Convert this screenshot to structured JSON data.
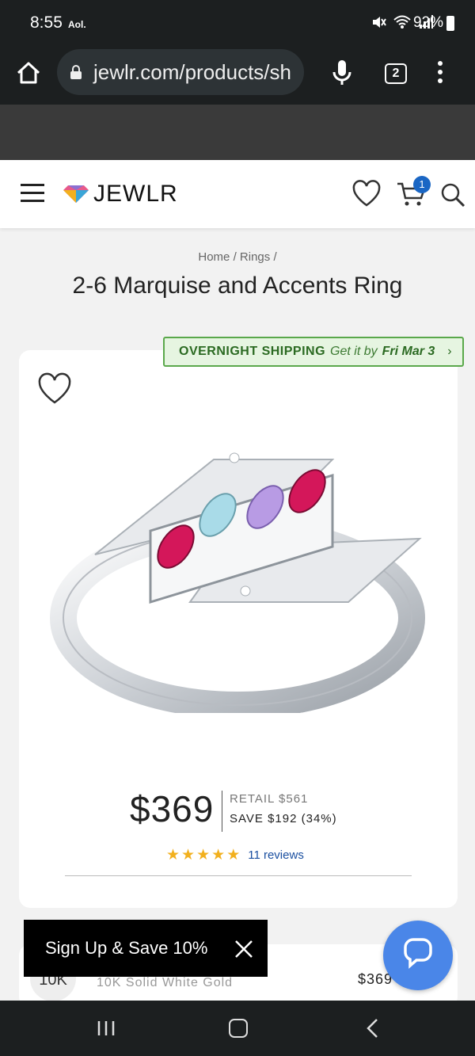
{
  "status_bar": {
    "time": "8:55",
    "carrier": "Aol.",
    "battery": "92%"
  },
  "browser": {
    "url": "jewlr.com/products/sh",
    "tab_count": "2"
  },
  "site_header": {
    "logo_text": "JEWLR",
    "cart_count": "1"
  },
  "breadcrumb": {
    "home": "Home",
    "sep1": "/",
    "rings": "Rings",
    "sep2": "/"
  },
  "product": {
    "title": "2-6 Marquise and Accents Ring",
    "shipping": {
      "label": "OVERNIGHT SHIPPING",
      "sub": "Get it by",
      "date": "Fri Mar 3",
      "chevron": "›"
    },
    "price": "$369",
    "retail": "RETAIL $561",
    "save": "SAVE $192 (34%)",
    "rating": {
      "stars": 5,
      "reviews": "11 reviews"
    },
    "colors": {
      "star": "#f2b01e",
      "shipping_bg": "#e6f5e1",
      "shipping_border": "#5aa84b",
      "link": "#1a4fa0"
    }
  },
  "variant": {
    "badge": "10K",
    "name": "10K Solid White Gold",
    "price": "$369"
  },
  "signup_bar": {
    "label": "Sign Up & Save 10%"
  },
  "icons": {
    "home": "home-icon",
    "lock": "lock-icon",
    "mic": "mic-icon",
    "tabs": "tabs-icon",
    "more": "kebab-icon",
    "menu": "hamburger-icon",
    "wishlist": "heart-icon",
    "cart": "cart-icon",
    "search": "search-icon",
    "chat": "chat-icon",
    "close": "close-icon"
  }
}
